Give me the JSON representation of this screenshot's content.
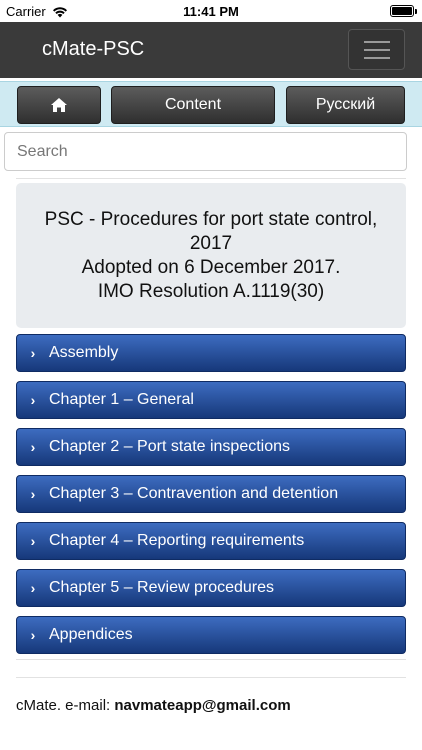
{
  "status_bar": {
    "carrier": "Carrier",
    "time": "11:41 PM"
  },
  "navbar": {
    "brand": "cMate-PSC"
  },
  "toolbar": {
    "home_icon": "home-icon",
    "content_label": "Content",
    "lang_label": "Русский"
  },
  "search": {
    "placeholder": "Search",
    "value": ""
  },
  "title_box": {
    "line1": "PSC - Procedures for port state control,",
    "line2": "2017",
    "line3": "Adopted on 6 December 2017.",
    "line4": "IMO Resolution A.1119(30)"
  },
  "sections": [
    {
      "label": "Assembly"
    },
    {
      "label": "Chapter 1 – General"
    },
    {
      "label": "Chapter 2 – Port state inspections"
    },
    {
      "label": "Chapter 3 – Contravention and detention"
    },
    {
      "label": "Chapter 4 – Reporting requirements"
    },
    {
      "label": "Chapter 5 – Review procedures"
    },
    {
      "label": "Appendices"
    }
  ],
  "footer": {
    "prefix": "cMate. e-mail: ",
    "email": "navmateapp@gmail.com"
  },
  "colors": {
    "navbar": "#3a3a3a",
    "toolbar_bg": "#cfeaf2",
    "section_blue": "#2a509c"
  }
}
